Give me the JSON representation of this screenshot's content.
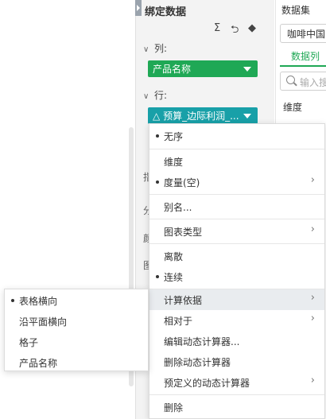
{
  "bind_panel": {
    "title": "绑定数据",
    "toolbar_icons": [
      "sum-icon",
      "swap-icon",
      "eraser-icon"
    ],
    "columns_label": "列:",
    "columns_pill": "产品名称",
    "rows_label": "行:",
    "rows_pill": "预算_边际利润_...",
    "frag_1": "指",
    "frag_2": "分",
    "frag_3": "颜",
    "frag_4": "图"
  },
  "dataset_panel": {
    "title": "数据集",
    "select_value": "咖啡中国",
    "tab_label": "数据列",
    "search_placeholder": "输入搜",
    "dimension_label": "维度"
  },
  "context_menu": {
    "items": [
      {
        "label": "无序",
        "checked": true
      },
      {
        "label": "维度",
        "checked": false
      },
      {
        "label": "度量(空)",
        "checked": true,
        "submenu": true
      },
      {
        "label": "别名...",
        "checked": false
      },
      {
        "label": "图表类型",
        "checked": false,
        "submenu": true
      },
      {
        "label": "离散",
        "checked": false
      },
      {
        "label": "连续",
        "checked": true
      },
      {
        "label": "计算依据",
        "checked": false,
        "submenu": true,
        "highlighted": true
      },
      {
        "label": "相对于",
        "checked": false,
        "submenu": true
      },
      {
        "label": "编辑动态计算器...",
        "checked": false
      },
      {
        "label": "删除动态计算器",
        "checked": false
      },
      {
        "label": "预定义的动态计算器",
        "checked": false,
        "submenu": true
      },
      {
        "label": "删除",
        "checked": false
      }
    ]
  },
  "submenu": {
    "items": [
      {
        "label": "表格横向",
        "checked": true
      },
      {
        "label": "沿平面横向",
        "checked": false
      },
      {
        "label": "格子",
        "checked": false
      },
      {
        "label": "产品名称",
        "checked": false
      }
    ]
  },
  "colors": {
    "accent_green": "#1fa855",
    "accent_teal": "#18a0a8",
    "menu_highlight": "#e9ecef"
  }
}
